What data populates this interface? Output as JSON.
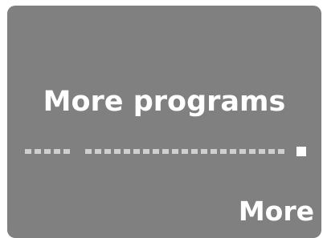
{
  "card": {
    "title": "More programs",
    "more_label": "More"
  },
  "pager": {
    "groups": [
      {
        "name": "first",
        "dash_count": 5
      },
      {
        "name": "second",
        "dash_count": 21
      }
    ],
    "current_indicator": "square",
    "colors": {
      "dash": "#cfcfcf",
      "active": "#ffffff",
      "card_bg": "#808080"
    }
  }
}
